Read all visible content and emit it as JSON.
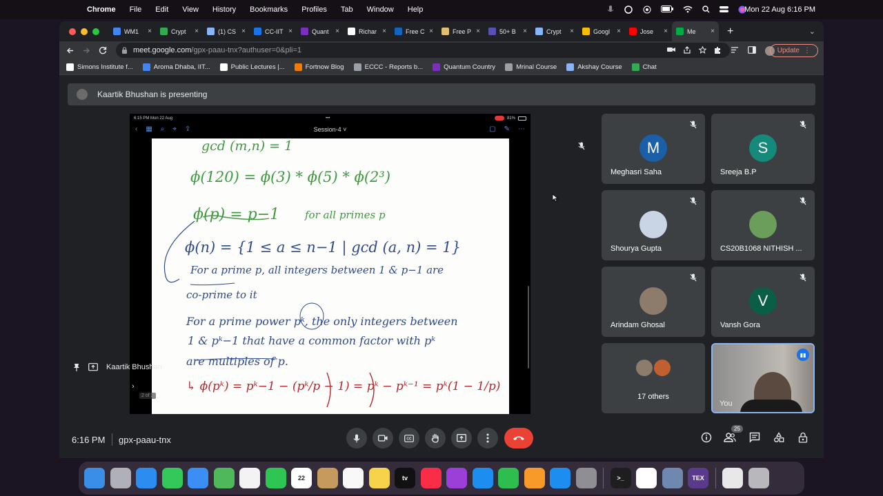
{
  "menubar": {
    "app": "Chrome",
    "items": [
      "File",
      "Edit",
      "View",
      "History",
      "Bookmarks",
      "Profiles",
      "Tab",
      "Window",
      "Help"
    ],
    "clock": "Mon 22 Aug  6:16 PM"
  },
  "tabs": [
    {
      "label": "WM1",
      "color": "#4285f4"
    },
    {
      "label": "Crypt",
      "color": "#34a853"
    },
    {
      "label": "(1) CS",
      "color": "#8ab4f8"
    },
    {
      "label": "CC-IIT",
      "color": "#1a73e8"
    },
    {
      "label": "Quant",
      "color": "#7b2fbe"
    },
    {
      "label": "Richar",
      "color": "#ffffff"
    },
    {
      "label": "Free C",
      "color": "#1565c0"
    },
    {
      "label": "Free P",
      "color": "#e0c070"
    },
    {
      "label": "50+ B",
      "color": "#5a4fb3"
    },
    {
      "label": "Crypt",
      "color": "#8ab4f8"
    },
    {
      "label": "Googl",
      "color": "#fbbc04"
    },
    {
      "label": "Jose",
      "color": "#ff0000"
    },
    {
      "label": "Me",
      "color": "#00ac47",
      "active": true
    }
  ],
  "toolbar": {
    "url_host": "meet.google.com",
    "url_path": "/gpx-paau-tnx?authuser=0&pli=1",
    "update_label": "Update"
  },
  "bookmarks": [
    {
      "label": "Simons Institute f...",
      "color": "#ffffff"
    },
    {
      "label": "Aroma Dhaba, IIT...",
      "color": "#4285f4"
    },
    {
      "label": "Public Lectures |...",
      "color": "#ffffff"
    },
    {
      "label": "Fortnow Blog",
      "color": "#f57c00"
    },
    {
      "label": "ECCC - Reports b...",
      "color": "#9aa0a6"
    },
    {
      "label": "Quantum Country",
      "color": "#7b2fbe"
    },
    {
      "label": "Mrinal Course",
      "color": "#9aa0a6"
    },
    {
      "label": "Akshay Course",
      "color": "#8ab4f8"
    },
    {
      "label": "Chat",
      "color": "#34a853"
    }
  ],
  "meet": {
    "presenting_text": "Kaartik Bhushan is presenting",
    "presenter_name": "Kaartik Bhushan",
    "time": "6:16 PM",
    "code": "gpx-paau-tnx",
    "participant_count": "25"
  },
  "slide": {
    "ipad_time": "6:15 PM   Mon 22 Aug",
    "ipad_battery": "81%",
    "doc_title": "Session-4 ˅",
    "page_indicator": "2 of 2",
    "lines": [
      {
        "text": "gcd (m,n) = 1",
        "color": "green"
      },
      {
        "text": "ϕ(120) =  ϕ(3) * ϕ(5) * ϕ(2³)",
        "color": "green"
      },
      {
        "text": "ϕ(p) = p−1",
        "color": "green"
      },
      {
        "text": "for all primes p",
        "color": "green"
      },
      {
        "text": "ϕ(n) = {1 ≤ a ≤ n−1  |  gcd (a, n) = 1}",
        "color": "blue"
      },
      {
        "text": "For a prime p, all integers  between 1 & p−1 are",
        "color": "blue"
      },
      {
        "text": "co-prime  to it",
        "color": "blue"
      },
      {
        "text": "For a prime power pᵏ, the only integers between",
        "color": "blue"
      },
      {
        "text": "1 & pᵏ−1  that have a common factor with pᵏ",
        "color": "blue"
      },
      {
        "text": "are  multiples of p.",
        "color": "blue"
      },
      {
        "text": "↳ ϕ(pᵏ) =  pᵏ−1 − (pᵏ/p − 1) = pᵏ − pᵏ⁻¹ = pᵏ(1 − 1/p)",
        "color": "red"
      }
    ]
  },
  "participants": [
    {
      "name": "Meghasri Saha",
      "initial": "M",
      "color": "#1a5fa8"
    },
    {
      "name": "Sreeja B.P",
      "initial": "S",
      "color": "#15897a"
    },
    {
      "name": "Shourya Gupta",
      "initial": "",
      "color": "#c9d4e4"
    },
    {
      "name": "CS20B1068 NITHISH ...",
      "initial": "",
      "color": "#6b9e5a"
    },
    {
      "name": "Arindam Ghosal",
      "initial": "",
      "color": "#8d7b6b"
    },
    {
      "name": "Vansh Gora",
      "initial": "V",
      "color": "#0b5e46"
    },
    {
      "name": "17 others",
      "initial": "",
      "color": "#7a6a5a"
    },
    {
      "name": "You",
      "initial": "",
      "color": "#8d8d8d"
    }
  ],
  "dock": [
    {
      "name": "finder",
      "label": "",
      "color": "#3a8ee6"
    },
    {
      "name": "launchpad",
      "label": "",
      "color": "#b0b0b8"
    },
    {
      "name": "safari",
      "label": "",
      "color": "#2d8cf0"
    },
    {
      "name": "messages",
      "label": "",
      "color": "#34c759"
    },
    {
      "name": "mail",
      "label": "",
      "color": "#3b8ef3"
    },
    {
      "name": "maps",
      "label": "",
      "color": "#4fb85a"
    },
    {
      "name": "photos",
      "label": "",
      "color": "#f3f3f3"
    },
    {
      "name": "facetime",
      "label": "",
      "color": "#2fc552"
    },
    {
      "name": "calendar",
      "label": "22",
      "color": "#ffffff"
    },
    {
      "name": "contacts",
      "label": "",
      "color": "#c69a5c"
    },
    {
      "name": "reminders",
      "label": "",
      "color": "#f8f8f8"
    },
    {
      "name": "notes",
      "label": "",
      "color": "#f6d34a"
    },
    {
      "name": "appletv",
      "label": "tv",
      "color": "#111111"
    },
    {
      "name": "music",
      "label": "",
      "color": "#fa2d48"
    },
    {
      "name": "podcasts",
      "label": "",
      "color": "#9c3fd8"
    },
    {
      "name": "keynote",
      "label": "",
      "color": "#1d8ef0"
    },
    {
      "name": "numbers",
      "label": "",
      "color": "#2ebd4f"
    },
    {
      "name": "pages",
      "label": "",
      "color": "#f79a2a"
    },
    {
      "name": "appstore",
      "label": "",
      "color": "#1d8ef0"
    },
    {
      "name": "systemprefs",
      "label": "",
      "color": "#8e8e93"
    },
    {
      "name": "terminal",
      "label": ">_",
      "color": "#1e1e1e"
    },
    {
      "name": "chrome",
      "label": "",
      "color": "#ffffff"
    },
    {
      "name": "preview",
      "label": "",
      "color": "#6f88b0"
    },
    {
      "name": "texshop",
      "label": "TEX",
      "color": "#5a3a8a"
    },
    {
      "name": "document",
      "label": "",
      "color": "#e8e8e8"
    },
    {
      "name": "trash",
      "label": "",
      "color": "#b8b8bc"
    }
  ]
}
